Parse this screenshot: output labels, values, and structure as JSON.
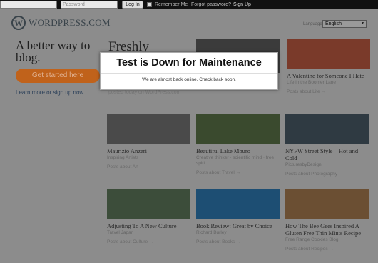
{
  "topbar": {
    "username_placeholder": "",
    "password_placeholder": "Password",
    "login_label": "Log In",
    "remember_label": "Remember Me",
    "forgot_label": "Forgot password?",
    "signup_label": "Sign Up"
  },
  "header": {
    "logo_mark": "W",
    "logo_text": "WordPress.com",
    "language_label": "Language:",
    "language_value": "English"
  },
  "left": {
    "tagline": "A better way to blog.",
    "cta_label": "Get started here",
    "learn_more": "Learn more",
    "or_text": "or",
    "signup_now": "sign up now"
  },
  "main": {
    "heading": "Freshly",
    "subtext": "posted today on WordPress.com"
  },
  "cards": [
    {
      "title": "A Valentine for Someone I Hate",
      "author": "Life in the Boomer Lane",
      "posts": "Posts about Life",
      "thumb_color": "#7a3a2a"
    },
    {
      "title": "Maurizio Anzeri",
      "author": "Inspiring Artists",
      "posts": "Posts about Art",
      "thumb_color": "#4a4a4a"
    },
    {
      "title": "Beautiful Lake Mburo",
      "author": "Creative thinker · scientific mind · free spirit",
      "posts": "Posts about Travel",
      "thumb_color": "#3a4a2e"
    },
    {
      "title": "NYFW Street Style – Hot and Cold",
      "author": "PicturesbyDesign",
      "posts": "Posts about Photography",
      "thumb_color": "#2f3a42"
    },
    {
      "title": "Adjusting To A New Culture",
      "author": "Travel Japan",
      "posts": "Posts about Culture",
      "thumb_color": "#3c4d3a"
    },
    {
      "title": "Book Review: Great by Choice",
      "author": "Richard Burley",
      "posts": "Posts about Books",
      "thumb_color": "#1d4e73"
    },
    {
      "title": "How The Bee Gees Inspired A Gluten Free Thin Mints Recipe",
      "author": "Free Range Cookies Blog",
      "posts": "Posts about Recipes",
      "thumb_color": "#6b4f33"
    }
  ],
  "modal": {
    "title": "Test is Down for Maintenance",
    "message": "We are almost back online. Check back soon."
  },
  "posts_arrow": "→"
}
